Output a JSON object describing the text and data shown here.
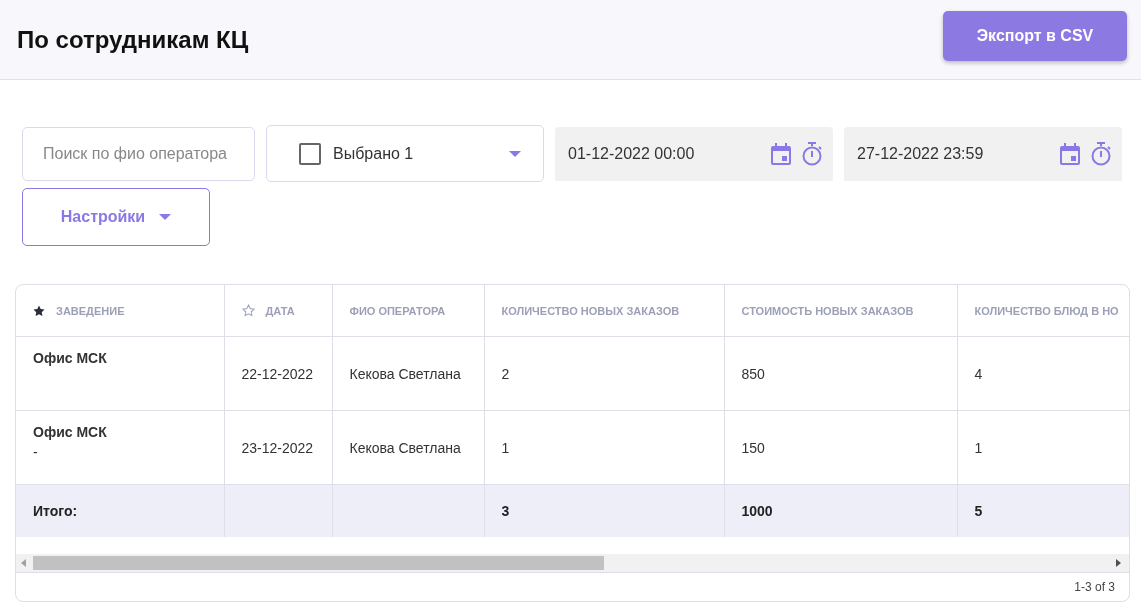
{
  "page": {
    "title": "По сотрудникам КЦ",
    "export_button": "Экспорт в CSV"
  },
  "filters": {
    "search": {
      "placeholder": "Поиск по фио оператора"
    },
    "select": {
      "checked": false,
      "label": "Выбрано 1"
    },
    "date_from": {
      "value": "01-12-2022 00:00"
    },
    "date_to": {
      "value": "27-12-2022 23:59"
    },
    "settings_button": "Настройки"
  },
  "table": {
    "columns": [
      {
        "label": "ЗАВЕДЕНИЕ",
        "kind": "star-filled"
      },
      {
        "label": "ДАТА",
        "kind": "star-outline"
      },
      {
        "label": "ФИО ОПЕРАТОРА",
        "kind": "plain"
      },
      {
        "label": "КОЛИЧЕСТВО НОВЫХ ЗАКАЗОВ",
        "kind": "plain"
      },
      {
        "label": "СТОИМОСТЬ НОВЫХ ЗАКАЗОВ",
        "kind": "plain"
      },
      {
        "label": "КОЛИЧЕСТВО БЛЮД В НО",
        "kind": "plain"
      }
    ],
    "rows": [
      {
        "kind": "data",
        "cells": [
          "Офис МСК",
          "22-12-2022",
          "Кекова Светлана",
          "2",
          "850",
          "4"
        ]
      },
      {
        "kind": "data",
        "venue_note": "-",
        "cells": [
          "Офис МСК",
          "23-12-2022",
          "Кекова Светлана",
          "1",
          "150",
          "1"
        ]
      },
      {
        "kind": "total",
        "cells": [
          "Итого:",
          "",
          "",
          "3",
          "1000",
          "5"
        ]
      }
    ],
    "pagination": "1-3 of 3"
  }
}
